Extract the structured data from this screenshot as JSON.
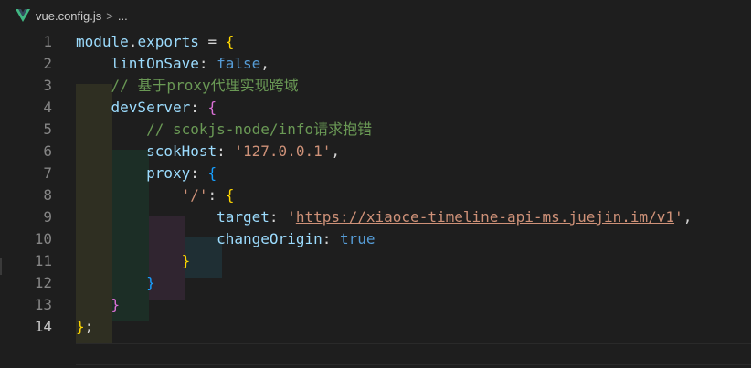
{
  "breadcrumb": {
    "file_icon": "vue-icon",
    "file_name": "vue.config.js",
    "separator": ">",
    "more": "..."
  },
  "editor": {
    "active_line": 14,
    "line_numbers": [
      "1",
      "2",
      "3",
      "4",
      "5",
      "6",
      "7",
      "8",
      "9",
      "10",
      "11",
      "12",
      "13",
      "14"
    ],
    "lines": [
      {
        "n": 1,
        "tokens": [
          {
            "t": "module",
            "c": "var"
          },
          {
            "t": ".",
            "c": "punct"
          },
          {
            "t": "exports",
            "c": "var"
          },
          {
            "t": " = ",
            "c": "punct"
          },
          {
            "t": "{",
            "c": "brace-gold"
          }
        ]
      },
      {
        "n": 2,
        "tokens": [
          {
            "t": "    "
          },
          {
            "t": "lintOnSave",
            "c": "var"
          },
          {
            "t": ": ",
            "c": "punct"
          },
          {
            "t": "false",
            "c": "kw"
          },
          {
            "t": ",",
            "c": "punct"
          }
        ]
      },
      {
        "n": 3,
        "tokens": [
          {
            "t": "    "
          },
          {
            "t": "// 基于proxy代理实现跨域",
            "c": "cmt"
          }
        ]
      },
      {
        "n": 4,
        "tokens": [
          {
            "t": "    "
          },
          {
            "t": "devServer",
            "c": "var"
          },
          {
            "t": ": ",
            "c": "punct"
          },
          {
            "t": "{",
            "c": "brace-pink"
          }
        ]
      },
      {
        "n": 5,
        "tokens": [
          {
            "t": "        "
          },
          {
            "t": "// scokjs-node/info请求抱错",
            "c": "cmt"
          }
        ]
      },
      {
        "n": 6,
        "tokens": [
          {
            "t": "        "
          },
          {
            "t": "scokHost",
            "c": "var"
          },
          {
            "t": ": ",
            "c": "punct"
          },
          {
            "t": "'127.0.0.1'",
            "c": "str"
          },
          {
            "t": ",",
            "c": "punct"
          }
        ]
      },
      {
        "n": 7,
        "tokens": [
          {
            "t": "        "
          },
          {
            "t": "proxy",
            "c": "var"
          },
          {
            "t": ": ",
            "c": "punct"
          },
          {
            "t": "{",
            "c": "brace-blue"
          }
        ]
      },
      {
        "n": 8,
        "tokens": [
          {
            "t": "            "
          },
          {
            "t": "'/'",
            "c": "str"
          },
          {
            "t": ": ",
            "c": "punct"
          },
          {
            "t": "{",
            "c": "brace-gold"
          }
        ]
      },
      {
        "n": 9,
        "tokens": [
          {
            "t": "                "
          },
          {
            "t": "target",
            "c": "var"
          },
          {
            "t": ": ",
            "c": "punct"
          },
          {
            "t": "'",
            "c": "str"
          },
          {
            "t": "https://xiaoce-timeline-api-ms.juejin.im/v1",
            "c": "str link"
          },
          {
            "t": "'",
            "c": "str"
          },
          {
            "t": ",",
            "c": "punct"
          }
        ]
      },
      {
        "n": 10,
        "tokens": [
          {
            "t": "                "
          },
          {
            "t": "changeOrigin",
            "c": "var"
          },
          {
            "t": ": ",
            "c": "punct"
          },
          {
            "t": "true",
            "c": "kw"
          }
        ]
      },
      {
        "n": 11,
        "tokens": [
          {
            "t": "            "
          },
          {
            "t": "}",
            "c": "brace-gold"
          }
        ]
      },
      {
        "n": 12,
        "tokens": [
          {
            "t": "        "
          },
          {
            "t": "}",
            "c": "brace-blue"
          }
        ]
      },
      {
        "n": 13,
        "tokens": [
          {
            "t": "    "
          },
          {
            "t": "}",
            "c": "brace-pink"
          }
        ]
      },
      {
        "n": 14,
        "tokens": [
          {
            "t": "}",
            "c": "brace-gold"
          },
          {
            "t": ";",
            "c": "punct"
          }
        ]
      }
    ]
  }
}
